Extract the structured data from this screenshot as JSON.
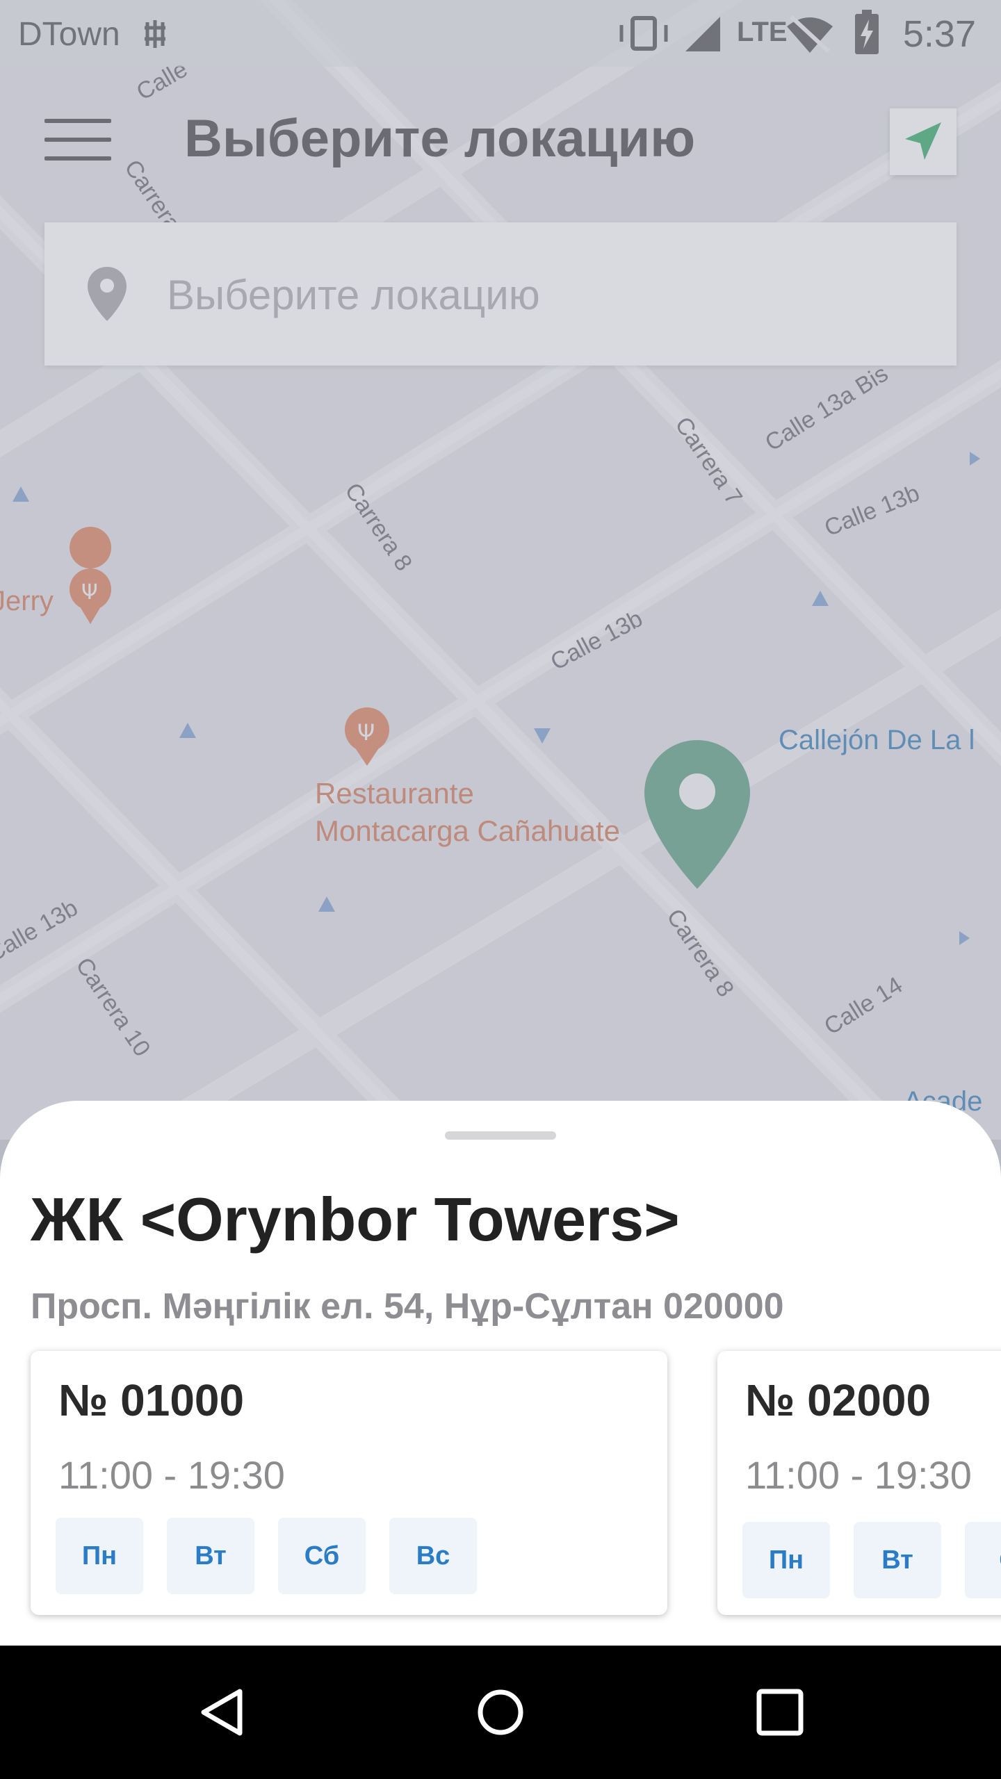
{
  "status_bar": {
    "carrier": "DTown",
    "network": "LTE",
    "time": "5:37"
  },
  "toolbar": {
    "title": "Выберите локацию"
  },
  "search": {
    "placeholder": "Выберите локацию"
  },
  "map": {
    "street_labels": [
      "Carrera 7",
      "Carrera 8",
      "Carrera 8",
      "Carrera 10",
      "Calle 13a Bis",
      "Calle 13b",
      "Calle 13b",
      "Calle 13b",
      "Calle 14",
      "Calle",
      "Carrera",
      "Callejón De La l",
      "Acade"
    ],
    "place_labels": [
      "Jerry",
      "Restaurante",
      "Montacarga Cañahuate"
    ],
    "marker_color": "#5fa886"
  },
  "residential_complex": {
    "name": "ЖК <Orynbor Towers>",
    "address": "Просп. Мәңгілік ел. 54, Нұр-Сұлтан 020000"
  },
  "offices": [
    {
      "number": "№ 01000",
      "hours": "11:00 - 19:30",
      "days": [
        "Пн",
        "Вт",
        "Сб",
        "Вс"
      ]
    },
    {
      "number": "№ 02000",
      "hours": "11:00 - 19:30",
      "days": [
        "Пн",
        "Вт",
        "С"
      ]
    }
  ],
  "colors": {
    "accent_green": "#5fa886",
    "day_chip_bg": "#eef4fa",
    "day_chip_text": "#2a7cc6"
  }
}
